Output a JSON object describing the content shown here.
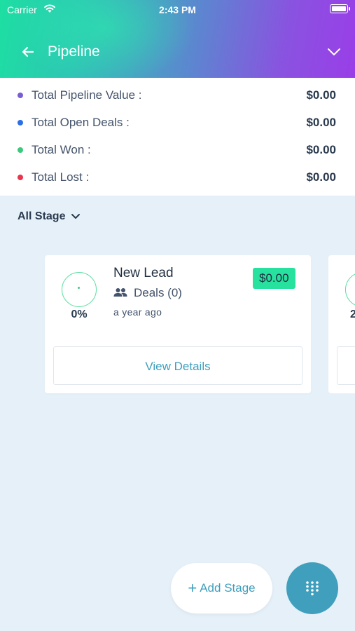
{
  "status_bar": {
    "carrier": "Carrier",
    "time": "2:43 PM"
  },
  "header": {
    "title": "Pipeline"
  },
  "summary": [
    {
      "label": "Total Pipeline Value :",
      "value": "$0.00",
      "color": "#7a5cd4"
    },
    {
      "label": "Total Open Deals :",
      "value": "$0.00",
      "color": "#2a6ee8"
    },
    {
      "label": "Total Won :",
      "value": "$0.00",
      "color": "#3cc97c"
    },
    {
      "label": "Total Lost :",
      "value": "$0.00",
      "color": "#e8364e"
    }
  ],
  "filter": {
    "label": "All Stage"
  },
  "stages": [
    {
      "name": "New Lead",
      "deals": "Deals (0)",
      "ago": "a year ago",
      "amount": "$0.00",
      "percent": "0%",
      "view_label": "View Details"
    }
  ],
  "peek_card": {
    "percent_partial": "2"
  },
  "actions": {
    "add_stage": "Add Stage",
    "add_stage_icon": "+"
  },
  "colors": {
    "accent": "#3f9fbd",
    "badge": "#27e29f"
  }
}
